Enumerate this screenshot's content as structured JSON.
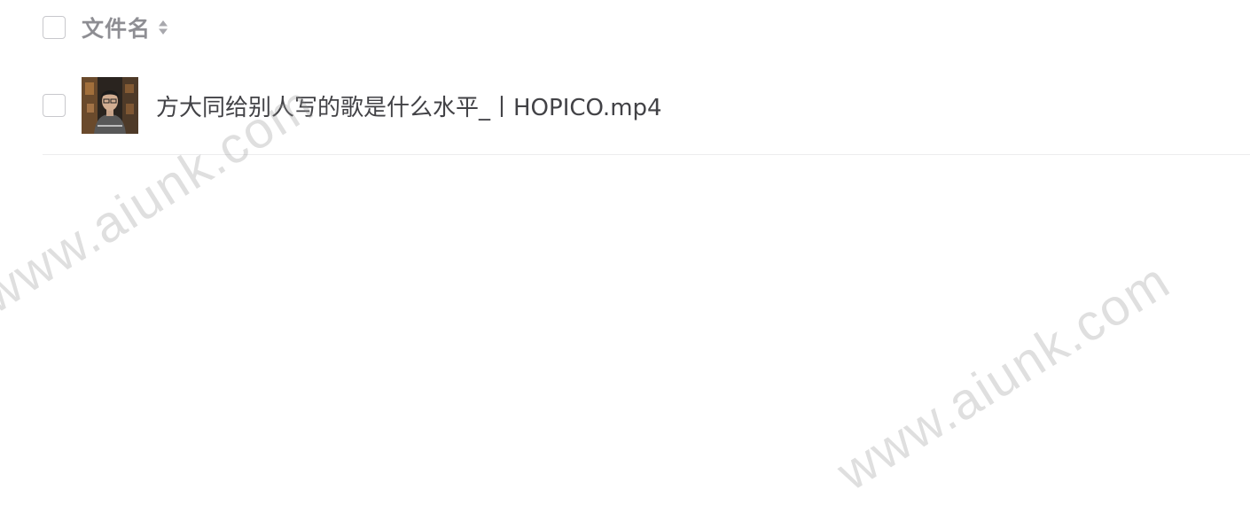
{
  "table": {
    "header": {
      "column_title": "文件名",
      "sort_icon": "sort-updown-icon"
    },
    "rows": [
      {
        "file_name": "方大同给别人写的歌是什么水平_丨HOPICO.mp4",
        "thumbnail_icon": "video-thumbnail"
      }
    ]
  },
  "watermarks": [
    "www.aiunk.com",
    "www.aiunk.com"
  ],
  "colors": {
    "header_text": "#8e8e93",
    "file_text": "#424246",
    "checkbox_border": "#c8c8cc",
    "divider": "#ececee",
    "watermark": "#8c8c8c"
  }
}
